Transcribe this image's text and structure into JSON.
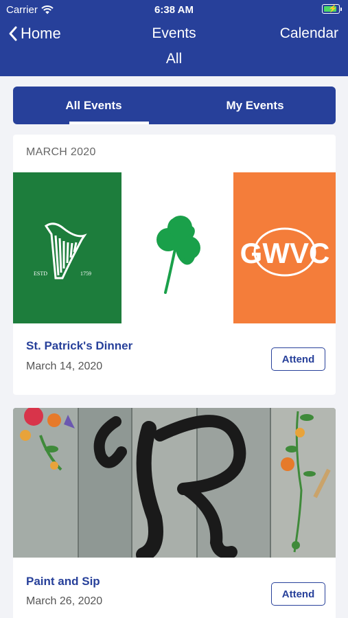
{
  "status_bar": {
    "carrier": "Carrier",
    "time": "6:38 AM"
  },
  "nav": {
    "back_label": "Home",
    "title": "Events",
    "subtitle": "All",
    "right_label": "Calendar"
  },
  "tabs": [
    {
      "label": "All Events",
      "active": true
    },
    {
      "label": "My Events",
      "active": false
    }
  ],
  "section": {
    "month_label": "MARCH 2020"
  },
  "events": [
    {
      "title": "St. Patrick's Dinner",
      "date": "March 14, 2020",
      "attend_label": "Attend"
    },
    {
      "title": "Paint and Sip",
      "date": "March 26, 2020",
      "attend_label": "Attend"
    }
  ],
  "colors": {
    "primary": "#27409a",
    "guinness_green": "#1d7d3c",
    "gwvc_orange": "#f47d3a",
    "clover_green": "#1aa04a"
  }
}
